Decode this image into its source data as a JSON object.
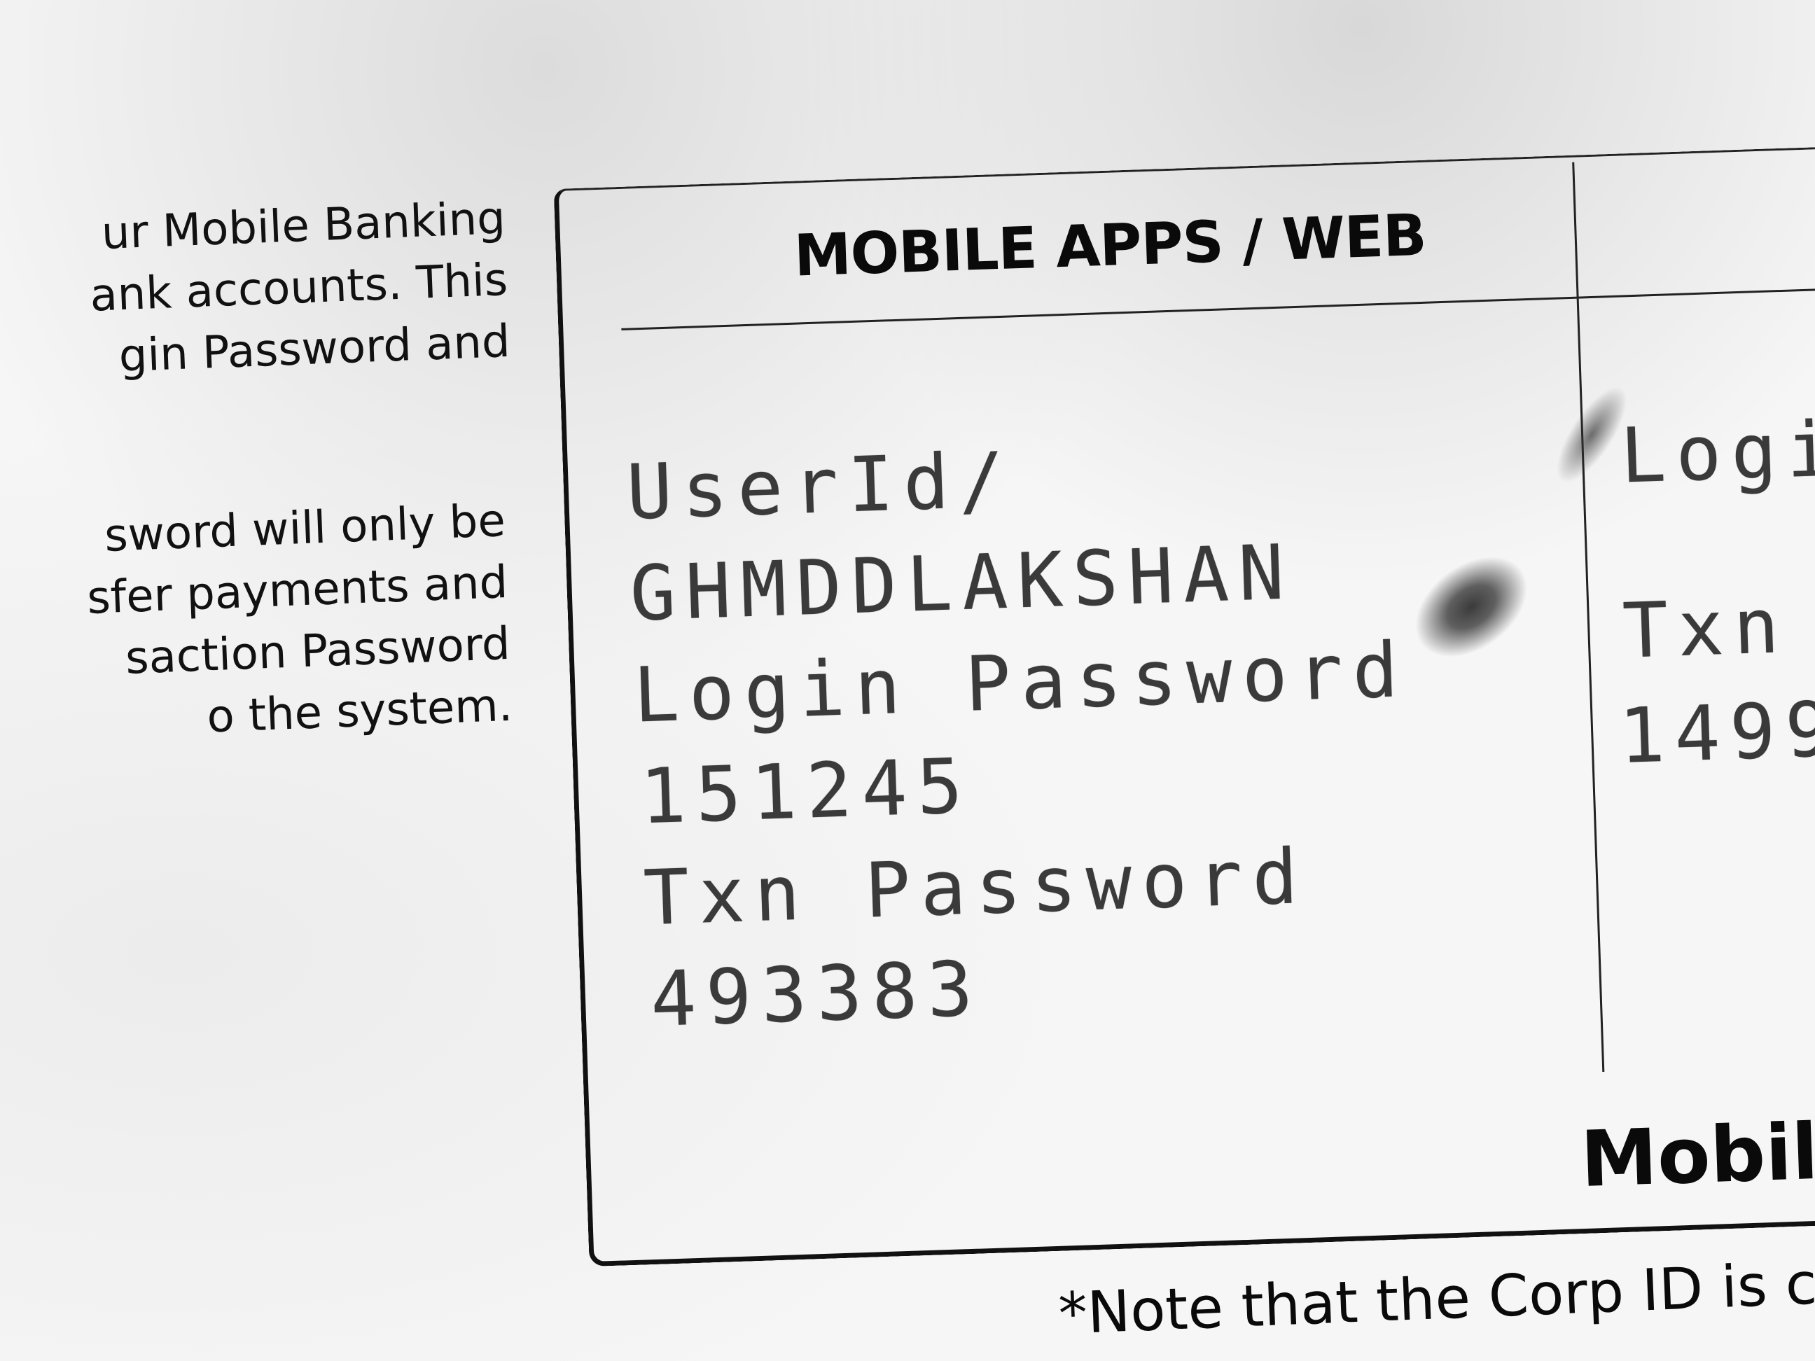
{
  "left_text": {
    "paragraph1": [
      "ur Mobile Banking",
      "ank accounts. This",
      "gin Password and"
    ],
    "paragraph2": [
      "sword will only be",
      "sfer payments and",
      "saction Password",
      "o the system."
    ]
  },
  "card": {
    "title": "MOBILE APPS / WEB",
    "fields": {
      "user_id_label": "UserId/",
      "user_id_value": "GHMDDLAKSHAN",
      "login_password_label": "Login Password",
      "login_password_value": "151245",
      "txn_password_label": "Txn Password",
      "txn_password_value": "493383"
    },
    "right_column": {
      "login_label_partial": "Logi",
      "txn_label_partial": "Txn",
      "value_partial": "1499"
    },
    "bottom_label": "Mobile"
  },
  "footer": {
    "note": "*Note that the Corp ID is c"
  }
}
